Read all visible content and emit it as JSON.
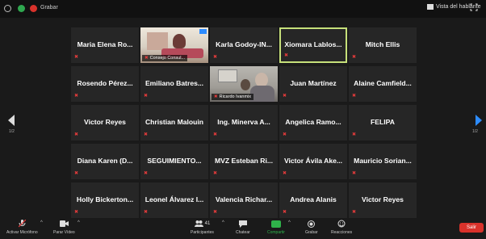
{
  "topbar": {
    "recording_label": "Grabar",
    "view_label": "Vista del hablante"
  },
  "grid": {
    "tiles": [
      {
        "type": "name",
        "name": "Maria Elena Ro..."
      },
      {
        "type": "video",
        "label": "Consejo Consul..."
      },
      {
        "type": "name",
        "name": "Karla Godoy-IN..."
      },
      {
        "type": "name",
        "name": "Xiomara Lablos...",
        "active": true
      },
      {
        "type": "name",
        "name": "Mitch Ellis"
      },
      {
        "type": "name",
        "name": "Rosendo Pérez..."
      },
      {
        "type": "name",
        "name": "Emiliano Batres..."
      },
      {
        "type": "video",
        "label": "Ricardo Ivanmix"
      },
      {
        "type": "name",
        "name": "Juan Martínez"
      },
      {
        "type": "name",
        "name": "Alaine Camfield..."
      },
      {
        "type": "name",
        "name": "Victor Reyes"
      },
      {
        "type": "name",
        "name": "Christian Malouin"
      },
      {
        "type": "name",
        "name": "Ing. Minerva A..."
      },
      {
        "type": "name",
        "name": "Angelica Ramo..."
      },
      {
        "type": "name",
        "name": "FELIPA"
      },
      {
        "type": "name",
        "name": "Diana Karen (D..."
      },
      {
        "type": "name",
        "name": "SEGUIMIENTO..."
      },
      {
        "type": "name",
        "name": "MVZ Esteban Ri..."
      },
      {
        "type": "name",
        "name": "Victor Ávila Ake..."
      },
      {
        "type": "name",
        "name": "Mauricio Sorian..."
      },
      {
        "type": "name",
        "name": "Holly Bickerton..."
      },
      {
        "type": "name",
        "name": "Leonel Álvarez I..."
      },
      {
        "type": "name",
        "name": "Valencia Richar..."
      },
      {
        "type": "name",
        "name": "Andrea Alanis"
      },
      {
        "type": "name",
        "name": "Victor Reyes"
      }
    ]
  },
  "pager": {
    "left_page": "1/2",
    "right_page": "1/2"
  },
  "toolbar": {
    "mic_label": "Activar Micrófono",
    "video_label": "Parar Vídeo",
    "participants_label": "Participantes",
    "participants_count": "41",
    "chat_label": "Chatear",
    "share_label": "Compartir",
    "record_label": "Grabar",
    "reactions_label": "Reacciones",
    "end_label": "Salir"
  },
  "colors": {
    "active_border": "#c6e07a",
    "share_green": "#2fb34a",
    "end_red": "#d9322b",
    "arrow_blue": "#2d8cff"
  }
}
